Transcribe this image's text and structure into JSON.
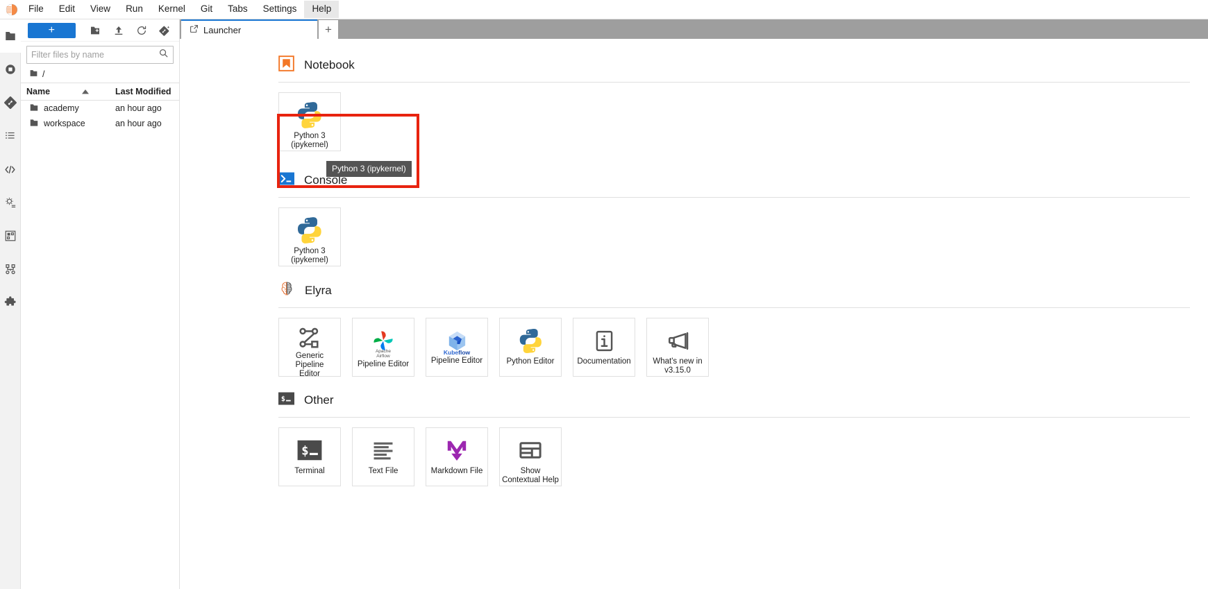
{
  "app": {
    "logo_icon": "jupyter-logo-icon",
    "menu": [
      {
        "label": "File",
        "active": false
      },
      {
        "label": "Edit",
        "active": false
      },
      {
        "label": "View",
        "active": false
      },
      {
        "label": "Run",
        "active": false
      },
      {
        "label": "Kernel",
        "active": false
      },
      {
        "label": "Git",
        "active": false
      },
      {
        "label": "Tabs",
        "active": false
      },
      {
        "label": "Settings",
        "active": false
      },
      {
        "label": "Help",
        "active": true
      }
    ]
  },
  "activitybar": {
    "items": [
      {
        "name": "file-browser-icon",
        "selected": true
      },
      {
        "name": "running-terminals-and-kernels-icon",
        "selected": false
      },
      {
        "name": "git-icon",
        "selected": false
      },
      {
        "name": "table-of-contents-icon",
        "selected": false
      },
      {
        "name": "code-snippets-icon",
        "selected": false
      },
      {
        "name": "property-inspector-icon",
        "selected": false
      },
      {
        "name": "extension-manager-icon",
        "selected": false
      },
      {
        "name": "pipeline-runtimes-icon",
        "selected": false
      },
      {
        "name": "extensions-puzzle-icon",
        "selected": false
      }
    ]
  },
  "filebrowser": {
    "toolbar": {
      "new_launcher_label": "+",
      "new_folder_icon": "new-folder-icon",
      "upload_icon": "upload-icon",
      "refresh_icon": "refresh-icon",
      "git_clone_icon": "git-clone-icon"
    },
    "filter": {
      "placeholder": "Filter files by name",
      "value": "",
      "search_icon": "search-icon"
    },
    "breadcrumb": {
      "folder_icon": "folder-icon",
      "path": "/"
    },
    "columns": {
      "name": "Name",
      "last_modified": "Last Modified",
      "sort_indicator": "sort-ascending-icon"
    },
    "rows": [
      {
        "icon": "folder-icon",
        "name": "academy",
        "last_modified": "an hour ago"
      },
      {
        "icon": "folder-icon",
        "name": "workspace",
        "last_modified": "an hour ago"
      }
    ]
  },
  "tabbar": {
    "tabs": [
      {
        "label": "Launcher",
        "icon": "launcher-icon",
        "active": true
      }
    ],
    "add_tab_label": "+"
  },
  "launcher": {
    "sections": [
      {
        "id": "notebook",
        "title": "Notebook",
        "icon": "notebook-icon",
        "cards": [
          {
            "label": "Python 3\n(ipykernel)",
            "icon": "python-logo-icon"
          }
        ]
      },
      {
        "id": "console",
        "title": "Console",
        "icon": "console-icon",
        "cards": [
          {
            "label": "Python 3\n(ipykernel)",
            "icon": "python-logo-icon"
          }
        ]
      },
      {
        "id": "elyra",
        "title": "Elyra",
        "icon": "elyra-brain-icon",
        "cards": [
          {
            "label": "Generic Pipeline\nEditor",
            "icon": "generic-pipeline-icon"
          },
          {
            "label": "Pipeline Editor",
            "icon": "apache-airflow-icon",
            "sublabel": "Apache\nAirflow"
          },
          {
            "label": "Pipeline Editor",
            "icon": "kubeflow-icon",
            "sublabel": "Kubeflow"
          },
          {
            "label": "Python Editor",
            "icon": "python-logo-icon"
          },
          {
            "label": "Documentation",
            "icon": "info-icon"
          },
          {
            "label": "What's new in\nv3.15.0",
            "icon": "megaphone-icon"
          }
        ]
      },
      {
        "id": "other",
        "title": "Other",
        "icon": "terminal-icon",
        "cards": [
          {
            "label": "Terminal",
            "icon": "terminal-icon"
          },
          {
            "label": "Text File",
            "icon": "text-file-icon"
          },
          {
            "label": "Markdown File",
            "icon": "markdown-icon"
          },
          {
            "label": "Show\nContextual Help",
            "icon": "contextual-help-icon"
          }
        ]
      }
    ]
  },
  "tooltip": {
    "text": "Python 3 (ipykernel)"
  },
  "annotation": {
    "color": "#e8230f",
    "target": "notebook-python3-card"
  },
  "colors": {
    "accent": "#1976d2",
    "annotation": "#e8230f",
    "tooltip_bg": "#545454",
    "tabbar_bg": "#9e9e9e"
  }
}
